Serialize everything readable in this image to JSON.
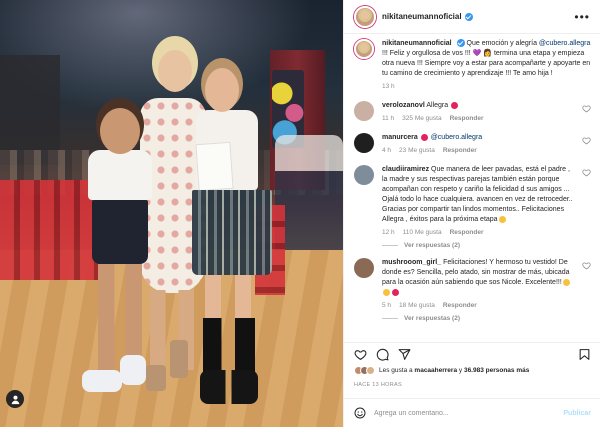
{
  "post": {
    "username": "nikitaneumannoficial",
    "verified": true,
    "photo": {
      "description_colors": {
        "accent": "#d43f7b",
        "verified": "#3897f0",
        "link": "#00376b"
      }
    }
  },
  "caption": {
    "username": "nikitaneumannoficial",
    "text_before": " Que emoción y alegría ",
    "mention": "@cubero.allegra",
    "text_after": " !!! Feliz y orgullosa de vos !!! 💜 👩 termina una etapa y empieza otra nueva !!! Siempre voy a estar para acompañarte y apoyarte en tu camino de crecimiento y aprendizaje !!! Te amo hija !",
    "time": "13 h"
  },
  "comments": [
    {
      "username": "verolozanovl",
      "text": " Allegra ",
      "time": "11 h",
      "likes": "325 Me gusta",
      "reply": "Responder",
      "avatar_color": "#c9b0a3"
    },
    {
      "username": "manurcera",
      "text": " ",
      "mention": "@cubero.allegra",
      "time": "4 h",
      "likes": "23 Me gusta",
      "reply": "Responder",
      "avatar_color": "#1f1f1f"
    },
    {
      "username": "claudiiramirez",
      "text": " Que manera de leer pavadas, está el padre , la madre y sus respectivas parejas también están porque acompañan con respeto y cariño la felicidad d sus amigos ... Ojalá todo lo hace cualquiera. avancen en vez de retroceder.. Gracias por compartir tan lindos momentos.. Felicitaciones Allegra , éxitos para la próxima etapa",
      "time": "12 h",
      "likes": "110 Me gusta",
      "reply": "Responder",
      "view_replies": "Ver respuestas (2)",
      "avatar_color": "#7f8c9a"
    },
    {
      "username": "mushrooom_girl_",
      "text": " Felicitaciones! Y hermoso tu vestido! De donde es? Sencilla, pelo atado, sin mostrar de más, ubicada para la ocasión aún sabiendo que sos Nicole. Excelente!!!",
      "time": "5 h",
      "likes": "18 Me gusta",
      "reply": "Responder",
      "view_replies": "Ver respuestas (2)",
      "avatar_color": "#8a6a55"
    }
  ],
  "likes": {
    "prefix": "Les gusta a ",
    "user": "macaaherrera",
    "middle": " y ",
    "count": "36.983 personas más"
  },
  "post_time": "HACE 13 HORAS",
  "add_comment": {
    "placeholder": "Agrega un comentario...",
    "publish": "Publicar"
  },
  "icons": {
    "more": "more-options-icon",
    "like": "heart-icon",
    "comment": "comment-icon",
    "share": "share-icon",
    "save": "bookmark-icon",
    "emoji": "emoji-icon",
    "tag": "user-tag-icon"
  }
}
